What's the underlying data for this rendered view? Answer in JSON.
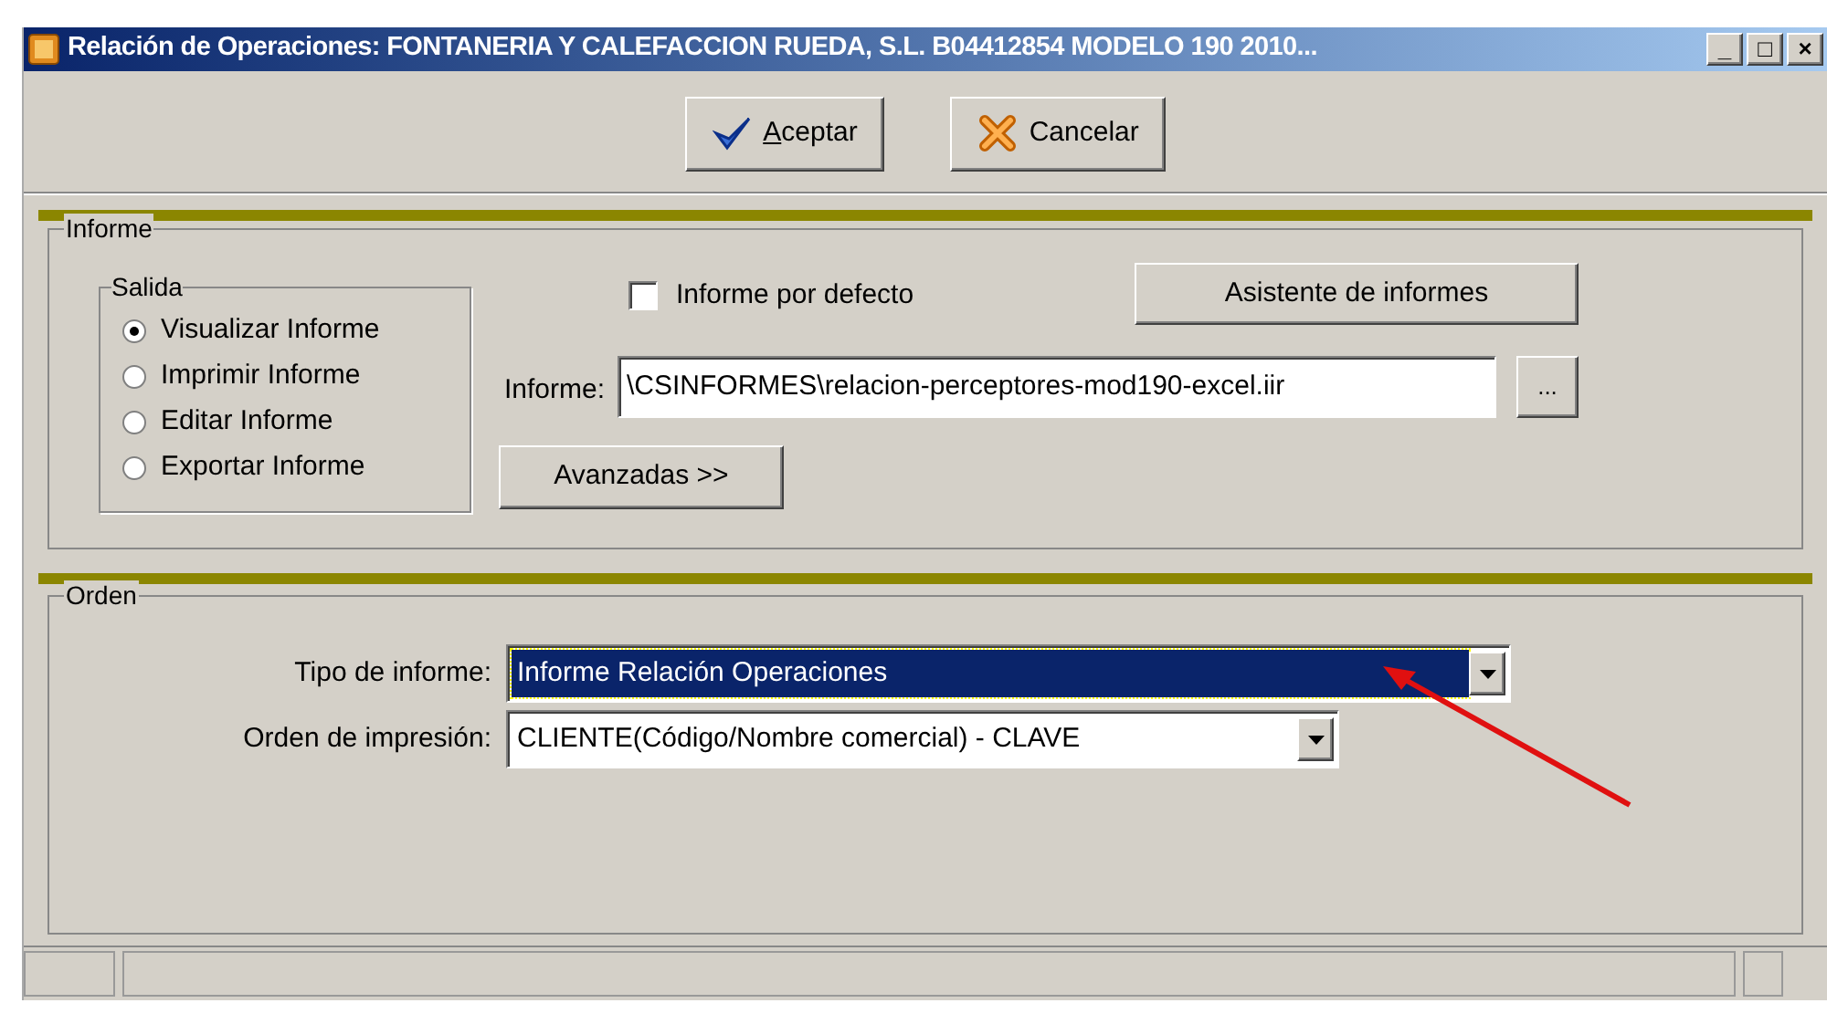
{
  "window": {
    "title": "Relación de Operaciones: FONTANERIA Y CALEFACCION RUEDA, S.L. B04412854  MODELO 190  2010...",
    "controls": [
      "_",
      "□",
      "×"
    ]
  },
  "toolbar": [
    {
      "label": "Aceptar",
      "mnemonic": true,
      "kind": "accept"
    },
    {
      "label": "Cancelar",
      "kind": "cancel"
    }
  ],
  "informe": {
    "title": "Informe",
    "salida": {
      "title": "Salida",
      "options": [
        {
          "label": "Visualizar Informe",
          "selected": true
        },
        {
          "label": "Imprimir Informe",
          "selected": false
        },
        {
          "label": "Editar Informe",
          "selected": false
        },
        {
          "label": "Exportar Informe",
          "selected": false
        }
      ]
    },
    "default_report": {
      "label": "Informe por defecto",
      "checked": false
    },
    "wizard_button": "Asistente de informes",
    "report_label": "Informe:",
    "report_value": "\\CSINFORMES\\relacion-perceptores-mod190-excel.iir",
    "browse_button": "...",
    "advanced_button": "Avanzadas >>"
  },
  "orden": {
    "title": "Orden",
    "fields": [
      {
        "label": "Tipo de informe:",
        "value": "Informe Relación Operaciones",
        "focused": true
      },
      {
        "label": "Orden de impresión:",
        "value": "CLIENTE(Código/Nombre comercial) - CLAVE",
        "focused": false
      }
    ]
  }
}
